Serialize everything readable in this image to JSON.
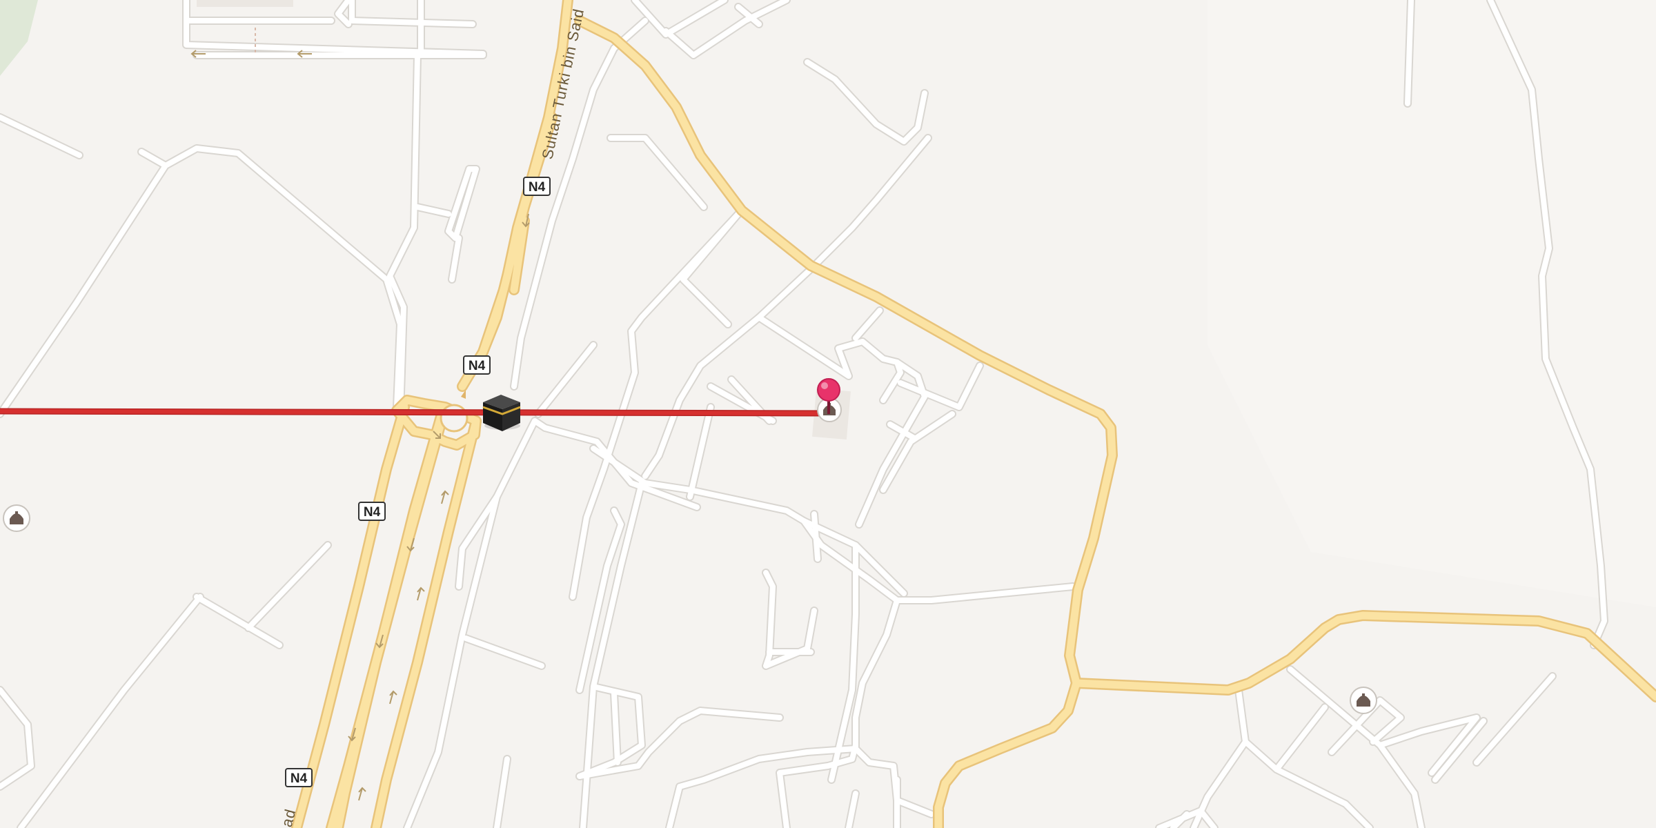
{
  "map": {
    "road_labels": {
      "sultan_turki_bin_said": "Sultan Turki bin Said",
      "bottom_left_fragment": "ad"
    },
    "route_shields": [
      "N4",
      "N4",
      "N4",
      "N4"
    ],
    "markers": {
      "kaaba_icon": "kaaba-icon",
      "destination_pin": "pin-icon",
      "mosque_icon": "mosque-icon"
    },
    "colors": {
      "background": "#f5f3f0",
      "street": "#ffffff",
      "major_road": "#fbe3a3",
      "route_line": "#d6302f",
      "pin": "#e8336a"
    }
  }
}
